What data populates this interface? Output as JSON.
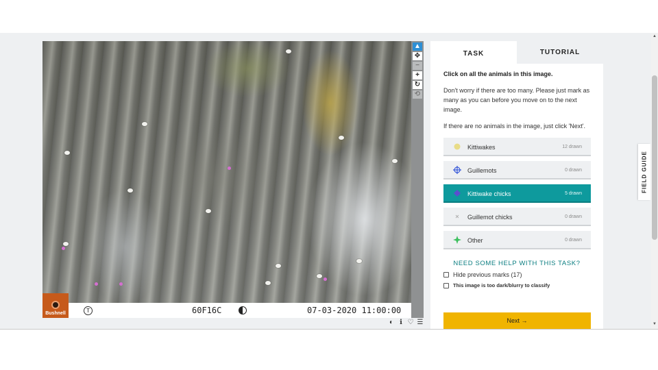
{
  "subject": {
    "brand": "Bushnell",
    "timer_glyph": "T",
    "camera_id": "60F16C",
    "timestamp": "07-03-2020 11:00:00"
  },
  "tools": {
    "pointer": "▲",
    "move": "✥",
    "zoom_out": "−",
    "zoom_in": "+",
    "rotate": "↻",
    "reset": "⟲"
  },
  "image_actions": {
    "invert": "◐",
    "info": "ℹ",
    "favorite": "♡",
    "collect": "☰"
  },
  "tabs": [
    {
      "label": "TASK",
      "active": true
    },
    {
      "label": "TUTORIAL",
      "active": false
    }
  ],
  "task": {
    "question": "Click on all the animals in this image.",
    "paragraph1": "Don't worry if there are too many. Please just mark as many as you can before you move on to the next image.",
    "paragraph2": "If there are no animals in the image, just click 'Next'.",
    "choices": [
      {
        "label": "Kittiwakes",
        "count": "12 drawn",
        "color": "#e6d35a",
        "icon": "circle-icon"
      },
      {
        "label": "Guillemots",
        "count": "0 drawn",
        "color": "#3a5bd9",
        "icon": "crosshair-icon"
      },
      {
        "label": "Kittiwake chicks",
        "count": "5 drawn",
        "color": "#5a4fcf",
        "icon": "diamond-icon"
      },
      {
        "label": "Guillemot chicks",
        "count": "0 drawn",
        "color": "#b0b0b0",
        "icon": "x-icon"
      },
      {
        "label": "Other",
        "count": "0 drawn",
        "color": "#3bbf5c",
        "icon": "star-icon"
      }
    ],
    "help": "NEED SOME HELP WITH THIS TASK?",
    "hide_marks": "Hide previous marks (17)",
    "too_dark": "This image is too dark/blurry to classify",
    "next": "Next →"
  },
  "field_guide": "FIELD GUIDE",
  "colors": {
    "accent": "#0e9a9d",
    "next_button": "#f0b400",
    "tool_active": "#2d8fd5"
  }
}
